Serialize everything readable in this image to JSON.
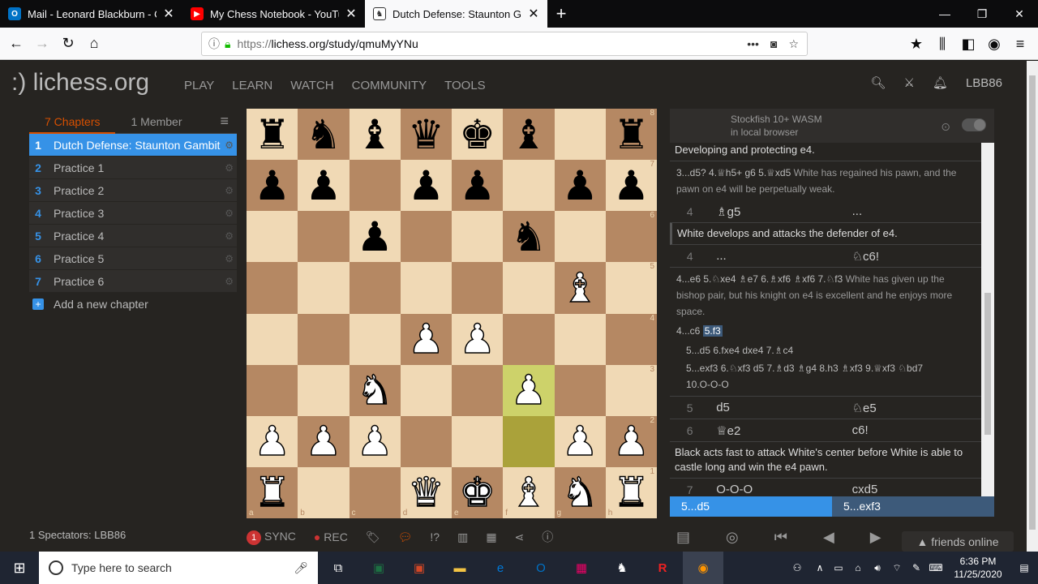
{
  "browser": {
    "tabs": [
      {
        "title": "Mail - Leonard Blackburn - Out",
        "icon": "outlook-icon",
        "color": "#0072c6"
      },
      {
        "title": "My Chess Notebook - YouTube",
        "icon": "youtube-icon",
        "color": "#ff0000"
      },
      {
        "title": "Dutch Defense: Staunton Gamb",
        "icon": "lichess-icon",
        "color": "#333333"
      }
    ],
    "url_prefix": "https://",
    "url": "lichess.org/study/qmuMyYNu"
  },
  "site": {
    "logo": ":) lichess.org",
    "menu": [
      "PLAY",
      "LEARN",
      "WATCH",
      "COMMUNITY",
      "TOOLS"
    ],
    "username": "LBB86"
  },
  "sidebar": {
    "tab_chapters": "7 Chapters",
    "tab_members": "1 Member",
    "chapters": [
      {
        "n": "1",
        "label": "Dutch Defense: Staunton Gambit"
      },
      {
        "n": "2",
        "label": "Practice 1"
      },
      {
        "n": "3",
        "label": "Practice 2"
      },
      {
        "n": "4",
        "label": "Practice 3"
      },
      {
        "n": "5",
        "label": "Practice 4"
      },
      {
        "n": "6",
        "label": "Practice 5"
      },
      {
        "n": "7",
        "label": "Practice 6"
      }
    ],
    "add_chapter": "Add a new chapter",
    "spectators": "1 Spectators: LBB86"
  },
  "board": {
    "ranks": [
      "rnbqkb1r",
      "pp1pp1pp",
      "2p2n2",
      "6B1",
      "3PP3",
      "2N2P2",
      "PPP3PP",
      "R2QKBNR"
    ],
    "highlight": [
      "f3",
      "f2"
    ],
    "files": [
      "a",
      "b",
      "c",
      "d",
      "e",
      "f",
      "g",
      "h"
    ]
  },
  "engine": {
    "line1": "Stockfish 10+ WASM",
    "line2": "in local browser"
  },
  "moves": {
    "c1": "Developing and protecting e4.",
    "v1a": "3...d5? 4.♕h5+ g6 5.♕xd5",
    "v1b": "White has regained his pawn, and the pawn on e4 will be perpetually weak.",
    "r4w_num": "4",
    "r4w_w": "♗g5",
    "r4w_b": "...",
    "c2": "White develops and attacks the defender of e4.",
    "r4b_num": "4",
    "r4b_w": "...",
    "r4b_b": "♘c6!",
    "v2a": "4...e6 5.♘xe4 ♗e7 6.♗xf6 ♗xf6 7.♘f3",
    "v2b": "White has given up the bishop pair, but his knight on e4 is excellent and he enjoys more space.",
    "v3a": "4...c6",
    "v3b": "5.f3",
    "v4": "5...d5 6.fxe4 dxe4 7.♗c4",
    "v5": "5...exf3 6.♘xf3 d5 7.♗d3 ♗g4 8.h3 ♗xf3 9.♕xf3 ♘bd7",
    "v6": "10.O-O-O",
    "r5_num": "5",
    "r5_w": "d5",
    "r5_b": "♘e5",
    "r6_num": "6",
    "r6_w": "♕e2",
    "r6_b": "c6!",
    "c3": "Black acts fast to attack White's center before White is able to castle long and win the e4 pawn.",
    "r7_num": "7",
    "r7_w": "O-O-O",
    "r7_b": "cxd5"
  },
  "current": {
    "a": "5...d5",
    "b": "5...exf3"
  },
  "tools": {
    "sync_count": "1",
    "sync": "SYNC",
    "rec": "REC"
  },
  "friends": "▲ friends online",
  "taskbar": {
    "search": "Type here to search",
    "time": "6:36 PM",
    "date": "11/25/2020"
  }
}
